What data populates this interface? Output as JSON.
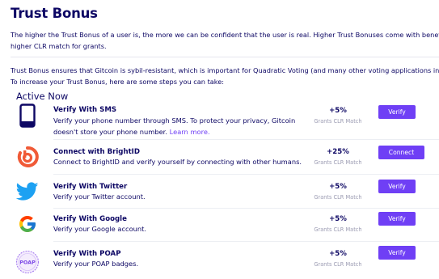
{
  "header": {
    "title": "Trust Bonus"
  },
  "intro": {
    "line1": "The higher the Trust Bonus of a user is, the more we can be confident that the user is real. Higher Trust Bonuses come with benefits, such as",
    "line2": "higher CLR match for grants.",
    "line3": "Trust Bonus ensures that Gitcoin is sybil-resistant, which is important for Quadratic Voting (and many other voting applications in web3!).",
    "line4": "To increase your Trust Bonus, here are some steps you can take:"
  },
  "section": {
    "heading": "Active Now"
  },
  "items": [
    {
      "icon": "phone-icon",
      "title": "Verify With SMS",
      "desc_line1": "Verify your phone number through SMS. To protect your privacy, Gitcoin",
      "desc_line2": "doesn't store your phone number.",
      "link": "Learn more.",
      "bonus": "+5%",
      "match_label": "Grants CLR Match",
      "button": "Verify"
    },
    {
      "icon": "brightid-icon",
      "title": "Connect with BrightID",
      "desc_line1": "Connect to BrightID and verify yourself by connecting with other humans.",
      "bonus": "+25%",
      "match_label": "Grants CLR Match",
      "button": "Connect"
    },
    {
      "icon": "twitter-bird-icon",
      "title": "Verify With Twitter",
      "desc_line1": "Verify your Twitter account.",
      "bonus": "+5%",
      "match_label": "Grants CLR Match",
      "button": "Verify"
    },
    {
      "icon": "google-g-icon",
      "title": "Verify With Google",
      "desc_line1": "Verify your Google account.",
      "bonus": "+5%",
      "match_label": "Grants CLR Match",
      "button": "Verify"
    },
    {
      "icon": "poap-badge-icon",
      "icon_text": "POAP",
      "title": "Verify With POAP",
      "desc_line1": "Verify your POAP badges.",
      "bonus": "+5%",
      "match_label": "Grants CLR Match",
      "button": "Verify"
    }
  ],
  "colors": {
    "text": "#0d0764",
    "accent": "#6f3ff5",
    "muted": "#9b9bb2",
    "brightid": "#f05a37",
    "twitter": "#1da1f2"
  }
}
